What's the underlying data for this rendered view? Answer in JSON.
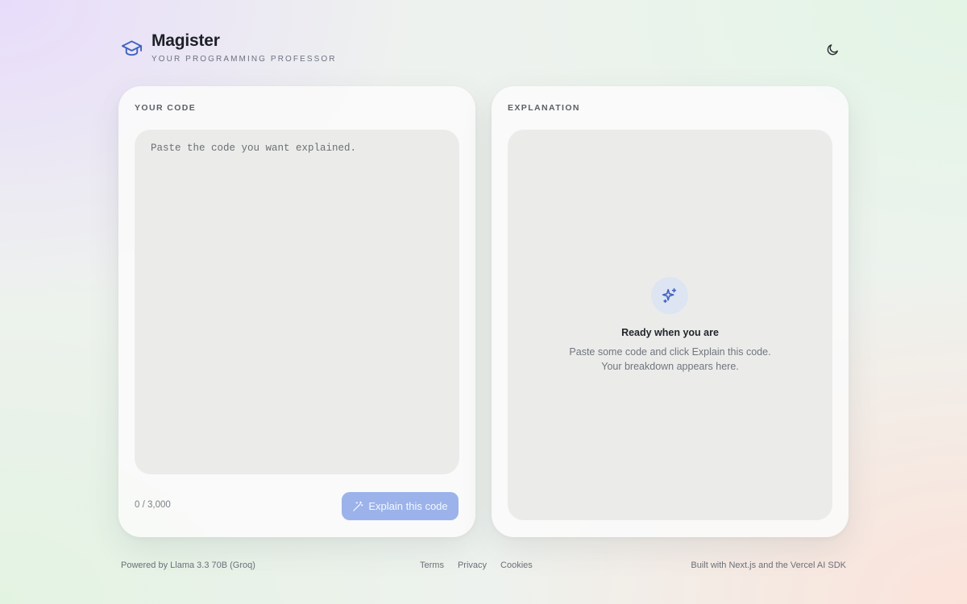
{
  "brand": {
    "title": "Magister",
    "subtitle": "YOUR PROGRAMMING PROFESSOR",
    "icon": "graduation-cap-icon",
    "accent_color": "#3f63c2"
  },
  "header": {
    "theme_toggle_icon": "moon-icon"
  },
  "code_panel": {
    "label": "YOUR CODE",
    "input_placeholder": "Paste the code you want explained.",
    "input_value": "",
    "char_count": "0 / 3,000",
    "button_label": "Explain this code",
    "button_icon": "magic-wand-icon",
    "button_color": "#9bb3ea"
  },
  "explanation_panel": {
    "label": "EXPLANATION",
    "empty_icon": "sparkles-icon",
    "empty_title": "Ready when you are",
    "empty_line1": "Paste some code and click Explain this code.",
    "empty_line2": "Your breakdown appears here."
  },
  "footer": {
    "powered_by": "Powered by Llama 3.3 70B (Groq)",
    "links": [
      "Terms",
      "Privacy",
      "Cookies"
    ],
    "built_with": "Built with Next.js and the Vercel AI SDK"
  }
}
